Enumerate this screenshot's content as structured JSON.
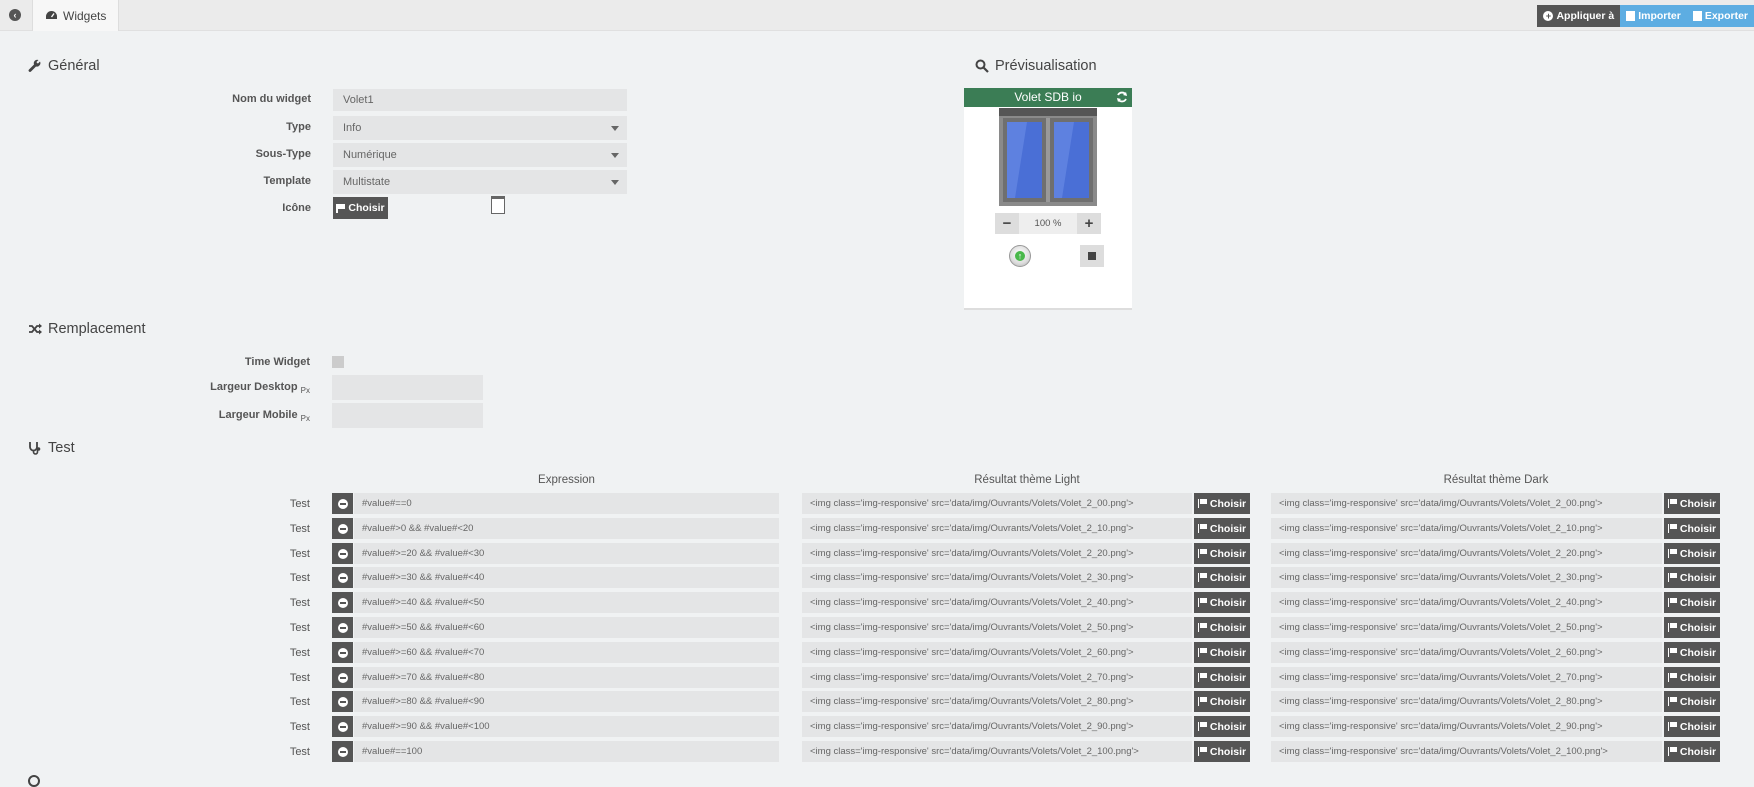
{
  "topbar": {
    "tab_label": "Widgets",
    "apply_label": "Appliquer à",
    "import_label": "Importer",
    "export_label": "Exporter"
  },
  "general": {
    "title": "Général",
    "name_label": "Nom du widget",
    "name_value": "Volet1",
    "type_label": "Type",
    "type_value": "Info",
    "subtype_label": "Sous-Type",
    "subtype_value": "Numérique",
    "template_label": "Template",
    "template_value": "Multistate",
    "icon_label": "Icône",
    "choose_label": "Choisir"
  },
  "preview": {
    "title": "Prévisualisation",
    "widget_name": "Volet SDB io",
    "value": "100 %",
    "minus": "−",
    "plus": "+"
  },
  "replacement": {
    "title": "Remplacement",
    "time_widget_label": "Time Widget",
    "width_desktop_label": "Largeur Desktop",
    "width_mobile_label": "Largeur Mobile",
    "unit": "Px"
  },
  "test": {
    "title": "Test",
    "col_expression": "Expression",
    "col_light": "Résultat thème Light",
    "col_dark": "Résultat thème Dark",
    "row_label": "Test",
    "choose_label": "Choisir",
    "rows": [
      {
        "expr": "#value#==0",
        "light": "<img class='img-responsive' src='data/img/Ouvrants/Volets/Volet_2_00.png'>",
        "dark": "<img class='img-responsive' src='data/img/Ouvrants/Volets/Volet_2_00.png'>"
      },
      {
        "expr": "#value#>0 && #value#<20",
        "light": "<img class='img-responsive' src='data/img/Ouvrants/Volets/Volet_2_10.png'>",
        "dark": "<img class='img-responsive' src='data/img/Ouvrants/Volets/Volet_2_10.png'>"
      },
      {
        "expr": "#value#>=20 && #value#<30",
        "light": "<img class='img-responsive' src='data/img/Ouvrants/Volets/Volet_2_20.png'>",
        "dark": "<img class='img-responsive' src='data/img/Ouvrants/Volets/Volet_2_20.png'>"
      },
      {
        "expr": "#value#>=30 && #value#<40",
        "light": "<img class='img-responsive' src='data/img/Ouvrants/Volets/Volet_2_30.png'>",
        "dark": "<img class='img-responsive' src='data/img/Ouvrants/Volets/Volet_2_30.png'>"
      },
      {
        "expr": "#value#>=40 && #value#<50",
        "light": "<img class='img-responsive' src='data/img/Ouvrants/Volets/Volet_2_40.png'>",
        "dark": "<img class='img-responsive' src='data/img/Ouvrants/Volets/Volet_2_40.png'>"
      },
      {
        "expr": "#value#>=50 && #value#<60",
        "light": "<img class='img-responsive' src='data/img/Ouvrants/Volets/Volet_2_50.png'>",
        "dark": "<img class='img-responsive' src='data/img/Ouvrants/Volets/Volet_2_50.png'>"
      },
      {
        "expr": "#value#>=60 && #value#<70",
        "light": "<img class='img-responsive' src='data/img/Ouvrants/Volets/Volet_2_60.png'>",
        "dark": "<img class='img-responsive' src='data/img/Ouvrants/Volets/Volet_2_60.png'>"
      },
      {
        "expr": "#value#>=70 && #value#<80",
        "light": "<img class='img-responsive' src='data/img/Ouvrants/Volets/Volet_2_70.png'>",
        "dark": "<img class='img-responsive' src='data/img/Ouvrants/Volets/Volet_2_70.png'>"
      },
      {
        "expr": "#value#>=80 && #value#<90",
        "light": "<img class='img-responsive' src='data/img/Ouvrants/Volets/Volet_2_80.png'>",
        "dark": "<img class='img-responsive' src='data/img/Ouvrants/Volets/Volet_2_80.png'>"
      },
      {
        "expr": "#value#>=90 && #value#<100",
        "light": "<img class='img-responsive' src='data/img/Ouvrants/Volets/Volet_2_90.png'>",
        "dark": "<img class='img-responsive' src='data/img/Ouvrants/Volets/Volet_2_90.png'>"
      },
      {
        "expr": "#value#==100",
        "light": "<img class='img-responsive' src='data/img/Ouvrants/Volets/Volet_2_100.png'>",
        "dark": "<img class='img-responsive' src='data/img/Ouvrants/Volets/Volet_2_100.png'>"
      }
    ]
  },
  "colors": {
    "accent_dark": "#555555",
    "accent_blue": "#5dade2",
    "header_green": "#3b7d55"
  }
}
